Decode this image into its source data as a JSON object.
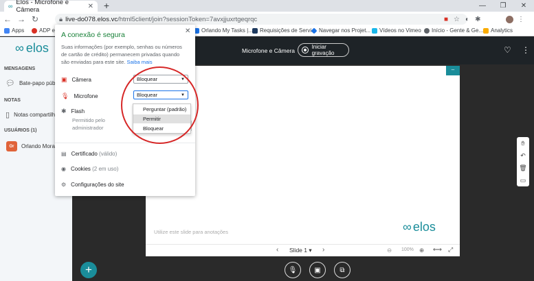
{
  "browser": {
    "tab_title": "Elos - Microfone e Câmera",
    "url_host": "live-do078.elos.vc",
    "url_path": "/html5client/join?sessionToken=7avxjjuxrtgeqrqc",
    "bookmarks": [
      {
        "label": "Apps",
        "icon": "apps-grid-icon",
        "color": "#4285f4"
      },
      {
        "label": "ADP e",
        "icon": "adp-icon",
        "color": "#d93025"
      },
      {
        "label": "Orlando My Tasks |...",
        "icon": "task-icon",
        "color": "#1a73e8"
      },
      {
        "label": "Requisições de Servi...",
        "icon": "ticket-icon",
        "color": "#1e3a5f"
      },
      {
        "label": "Navegar nos Projet...",
        "icon": "diamond-icon",
        "color": "#1a73e8"
      },
      {
        "label": "Vídeos no Vimeo",
        "icon": "vimeo-icon",
        "color": "#1ab7ea"
      },
      {
        "label": "Início - Gente & Ge...",
        "icon": "globe-icon",
        "color": "#5f6368"
      },
      {
        "label": "Analytics",
        "icon": "analytics-icon",
        "color": "#f9ab00"
      }
    ]
  },
  "app": {
    "logo": "elos",
    "sidebar": {
      "messages_header": "MENSAGENS",
      "public_chat": "Bate-papo públic",
      "notes_header": "NOTAS",
      "shared_notes": "Notas compartilh",
      "users_header": "USUÁRIOS (1)",
      "user_initials": "Or",
      "user_name": "Orlando Morals"
    },
    "topbar": {
      "title": "Microfone e Câmera",
      "record_label": "Iniciar gravação"
    },
    "slide": {
      "hint": "Utilize este slide para anotações",
      "brand": "elos",
      "nav_label": "Slide 1",
      "zoom": "100%"
    }
  },
  "popup": {
    "title": "A conexão é segura",
    "info": "Suas informações (por exemplo, senhas ou números de cartão de crédito) permanecem privadas quando são enviadas para este site.",
    "learn_more": "Saiba mais",
    "camera_label": "Câmera",
    "camera_value": "Bloquear",
    "mic_label": "Microfone",
    "mic_value": "Bloquear",
    "flash_label": "Flash",
    "flash_note": "Permitido pelo administrador",
    "dropdown_options": [
      "Perguntar (padrão)",
      "Permitir",
      "Bloquear"
    ],
    "highlighted_option": "Permitir",
    "certificate": "Certificado",
    "certificate_note": "(válido)",
    "cookies": "Cookies",
    "cookies_note": "(2 em uso)",
    "site_settings": "Configurações do site"
  },
  "colors": {
    "accent": "#1a8d9a",
    "secure_green": "#188038",
    "annotation_red": "#d62727"
  }
}
